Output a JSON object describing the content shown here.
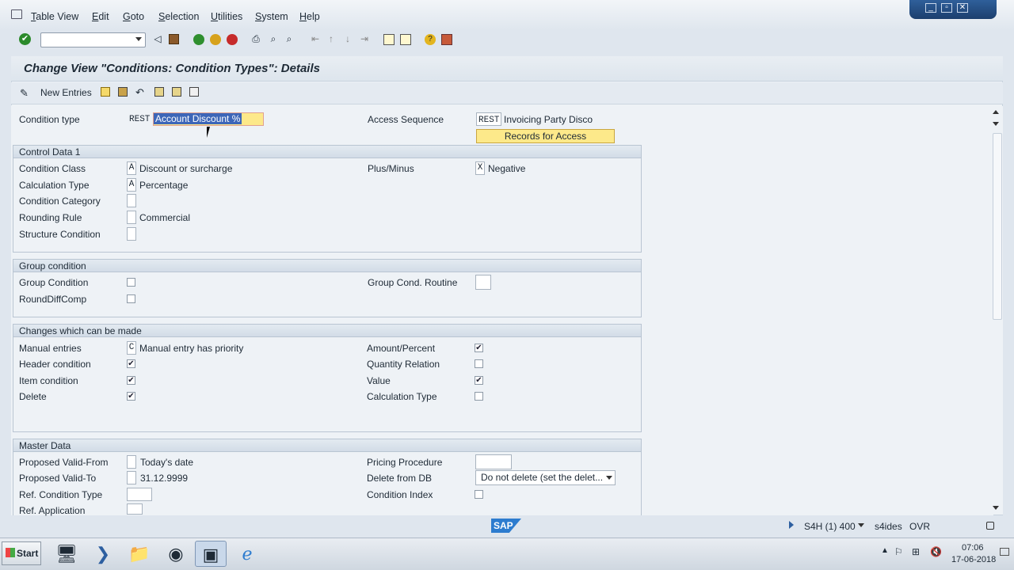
{
  "menu": [
    "Table View",
    "Edit",
    "Goto",
    "Selection",
    "Utilities",
    "System",
    "Help"
  ],
  "window_controls": [
    "minimize",
    "restore",
    "close"
  ],
  "title": "Change View \"Conditions: Condition Types\": Details",
  "app_toolbar": {
    "new_entries": "New Entries"
  },
  "header": {
    "condition_type_label": "Condition type",
    "condition_type_code": "REST",
    "condition_type_desc": "Account Discount %",
    "access_sequence_label": "Access Sequence",
    "access_sequence_code": "REST",
    "access_sequence_desc": "Invoicing Party Disco",
    "records_button": "Records for Access"
  },
  "control_data": {
    "title": "Control Data 1",
    "condition_class_label": "Condition Class",
    "condition_class_code": "A",
    "condition_class_text": "Discount or surcharge",
    "calc_type_label": "Calculation Type",
    "calc_type_code": "A",
    "calc_type_text": "Percentage",
    "cond_category_label": "Condition Category",
    "rounding_label": "Rounding Rule",
    "rounding_text": "Commercial",
    "structure_label": "Structure Condition",
    "plusminus_label": "Plus/Minus",
    "plusminus_code": "X",
    "plusminus_text": "Negative"
  },
  "group_condition": {
    "title": "Group condition",
    "group_cond_label": "Group Condition",
    "group_cond_checked": false,
    "rounddiff_label": "RoundDiffComp",
    "rounddiff_checked": false,
    "routine_label": "Group Cond. Routine"
  },
  "changes": {
    "title": "Changes which can be made",
    "manual_label": "Manual entries",
    "manual_code": "C",
    "manual_text": "Manual entry has priority",
    "header_label": "Header condition",
    "header_checked": true,
    "item_label": "Item condition",
    "item_checked": true,
    "delete_label": "Delete",
    "delete_checked": true,
    "amount_label": "Amount/Percent",
    "amount_checked": true,
    "qty_label": "Quantity Relation",
    "qty_checked": false,
    "value_label": "Value",
    "value_checked": true,
    "calc_label": "Calculation Type",
    "calc_checked": false
  },
  "master_data": {
    "title": "Master Data",
    "valid_from_label": "Proposed Valid-From",
    "valid_from_text": "Today's date",
    "valid_to_label": "Proposed Valid-To",
    "valid_to_text": "31.12.9999",
    "ref_cond_label": "Ref. Condition Type",
    "ref_app_label": "Ref. Application",
    "pricing_label": "Pricing Procedure",
    "delete_db_label": "Delete from DB",
    "delete_db_value": "Do not delete (set the delet...",
    "cond_index_label": "Condition Index",
    "cond_index_checked": false
  },
  "status": {
    "system": "S4H (1) 400",
    "server": "s4ides",
    "mode": "OVR"
  },
  "logo": "SAP",
  "taskbar": {
    "start": "Start",
    "time": "07:06",
    "date": "17-06-2018"
  },
  "colors": {
    "accent_yellow": "#fde98a",
    "selection": "#3c66b8",
    "title_bg": "#e3e9ef"
  }
}
